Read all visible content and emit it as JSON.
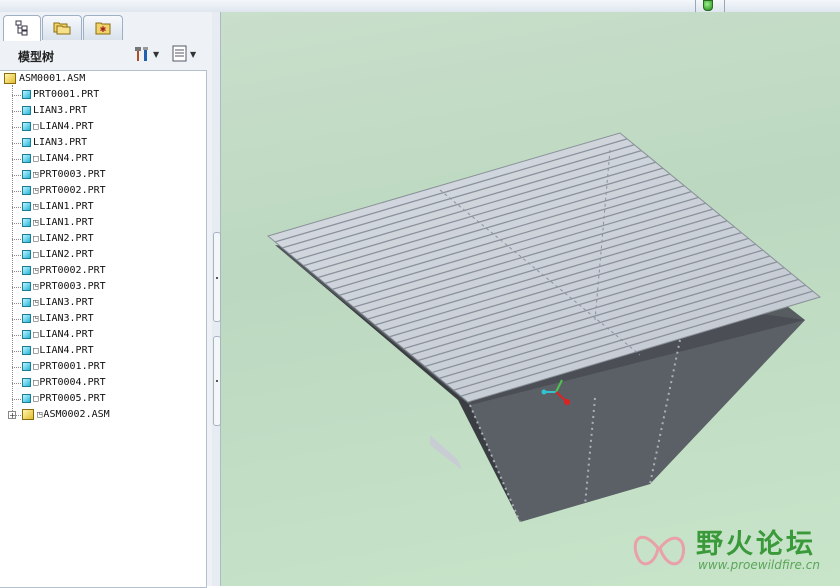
{
  "model_tree": {
    "title": "模型树",
    "settings_icon": "settings-icon",
    "show_icon": "show-icon",
    "nodes": [
      {
        "label": "ASM0001.ASM",
        "type": "assembly",
        "level": 0,
        "flag": ""
      },
      {
        "label": "PRT0001.PRT",
        "type": "part",
        "level": 1,
        "flag": ""
      },
      {
        "label": "LIAN3.PRT",
        "type": "part",
        "level": 1,
        "flag": ""
      },
      {
        "label": "LIAN4.PRT",
        "type": "part",
        "level": 1,
        "flag": "□"
      },
      {
        "label": "LIAN3.PRT",
        "type": "part",
        "level": 1,
        "flag": ""
      },
      {
        "label": "LIAN4.PRT",
        "type": "part",
        "level": 1,
        "flag": "□"
      },
      {
        "label": "PRT0003.PRT",
        "type": "part",
        "level": 1,
        "flag": "◳"
      },
      {
        "label": "PRT0002.PRT",
        "type": "part",
        "level": 1,
        "flag": "◳"
      },
      {
        "label": "LIAN1.PRT",
        "type": "part",
        "level": 1,
        "flag": "◳"
      },
      {
        "label": "LIAN1.PRT",
        "type": "part",
        "level": 1,
        "flag": "◳"
      },
      {
        "label": "LIAN2.PRT",
        "type": "part",
        "level": 1,
        "flag": "□"
      },
      {
        "label": "LIAN2.PRT",
        "type": "part",
        "level": 1,
        "flag": "□"
      },
      {
        "label": "PRT0002.PRT",
        "type": "part",
        "level": 1,
        "flag": "◳"
      },
      {
        "label": "PRT0003.PRT",
        "type": "part",
        "level": 1,
        "flag": "◳"
      },
      {
        "label": "LIAN3.PRT",
        "type": "part",
        "level": 1,
        "flag": "◳"
      },
      {
        "label": "LIAN3.PRT",
        "type": "part",
        "level": 1,
        "flag": "◳"
      },
      {
        "label": "LIAN4.PRT",
        "type": "part",
        "level": 1,
        "flag": "□"
      },
      {
        "label": "LIAN4.PRT",
        "type": "part",
        "level": 1,
        "flag": "□"
      },
      {
        "label": "PRT0001.PRT",
        "type": "part",
        "level": 1,
        "flag": "□"
      },
      {
        "label": "PRT0004.PRT",
        "type": "part",
        "level": 1,
        "flag": "□"
      },
      {
        "label": "PRT0005.PRT",
        "type": "part",
        "level": 1,
        "flag": "□"
      },
      {
        "label": "ASM0002.ASM",
        "type": "assembly",
        "level": 1,
        "flag": "◳",
        "expandable": true
      }
    ]
  },
  "tabs": [
    {
      "name": "model-tree-tab",
      "icon": "tree-icon"
    },
    {
      "name": "folder-browser-tab",
      "icon": "folders-icon"
    },
    {
      "name": "favorites-tab",
      "icon": "favorites-icon"
    }
  ],
  "watermark": {
    "title": "野火论坛",
    "url": "www.proewildfire.cn"
  },
  "colors": {
    "viewport_bg": "#c2dcc5",
    "model_body": "#505458",
    "grill": "#c9ced6",
    "watermark": "#3a9a3a"
  }
}
